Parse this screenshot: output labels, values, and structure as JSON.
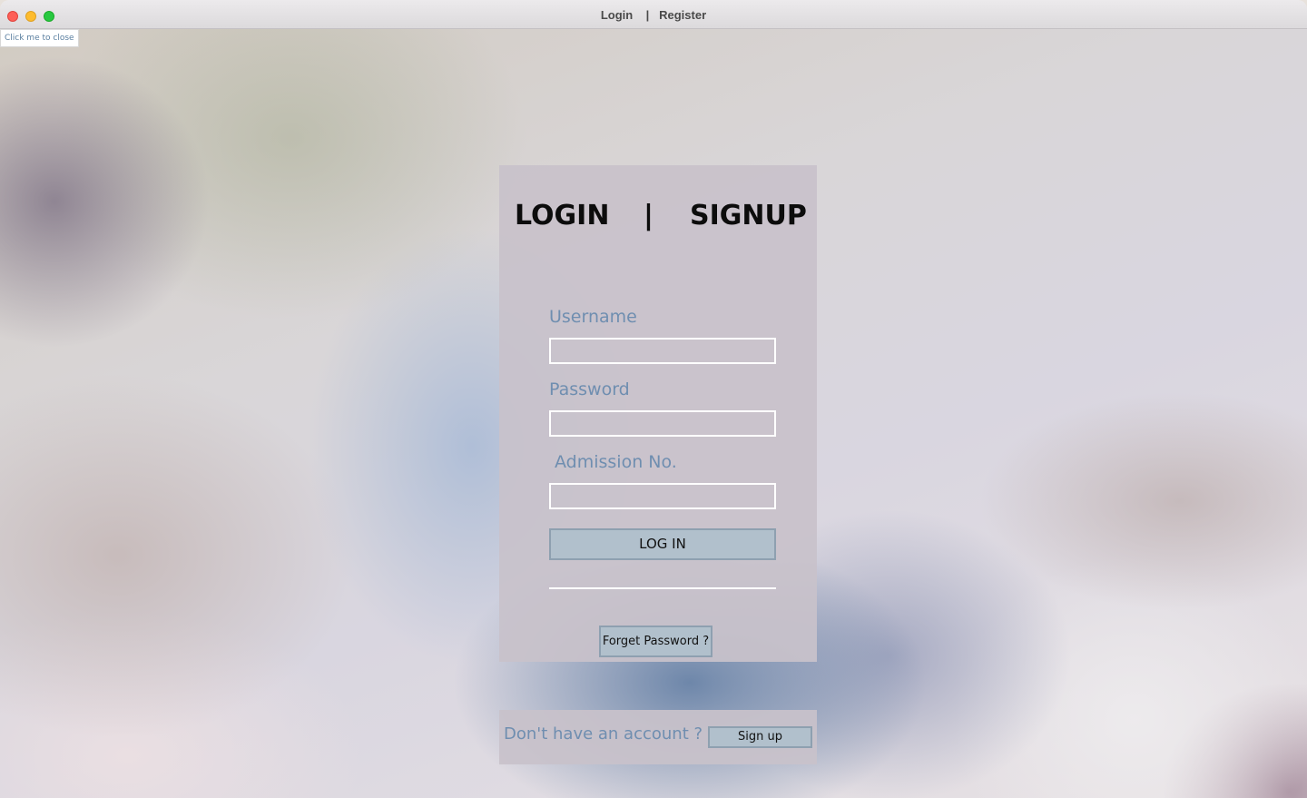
{
  "window": {
    "title": "Login    |   Register"
  },
  "tooltip": {
    "close_text": "Click me to close"
  },
  "login_card": {
    "heading_left": "LOGIN",
    "heading_sep": "|",
    "heading_right": "SIGNUP",
    "username_label": "Username",
    "username_value": "",
    "password_label": "Password",
    "password_value": "",
    "admission_label": "Admission No.",
    "admission_value": "",
    "login_button": "LOG IN",
    "forget_button": "Forget Password ?"
  },
  "signup_card": {
    "prompt": "Don't have an account ?",
    "signup_button": "Sign up"
  },
  "colors": {
    "card_background": "#c8c2ca",
    "label_color": "#6f8eb0",
    "button_background": "#b1c0cc",
    "button_border": "#8ea0b0",
    "input_border": "#ffffff"
  },
  "icons": {
    "close_button": "close-window-icon",
    "minimize_button": "minimize-window-icon",
    "zoom_button": "zoom-window-icon"
  }
}
